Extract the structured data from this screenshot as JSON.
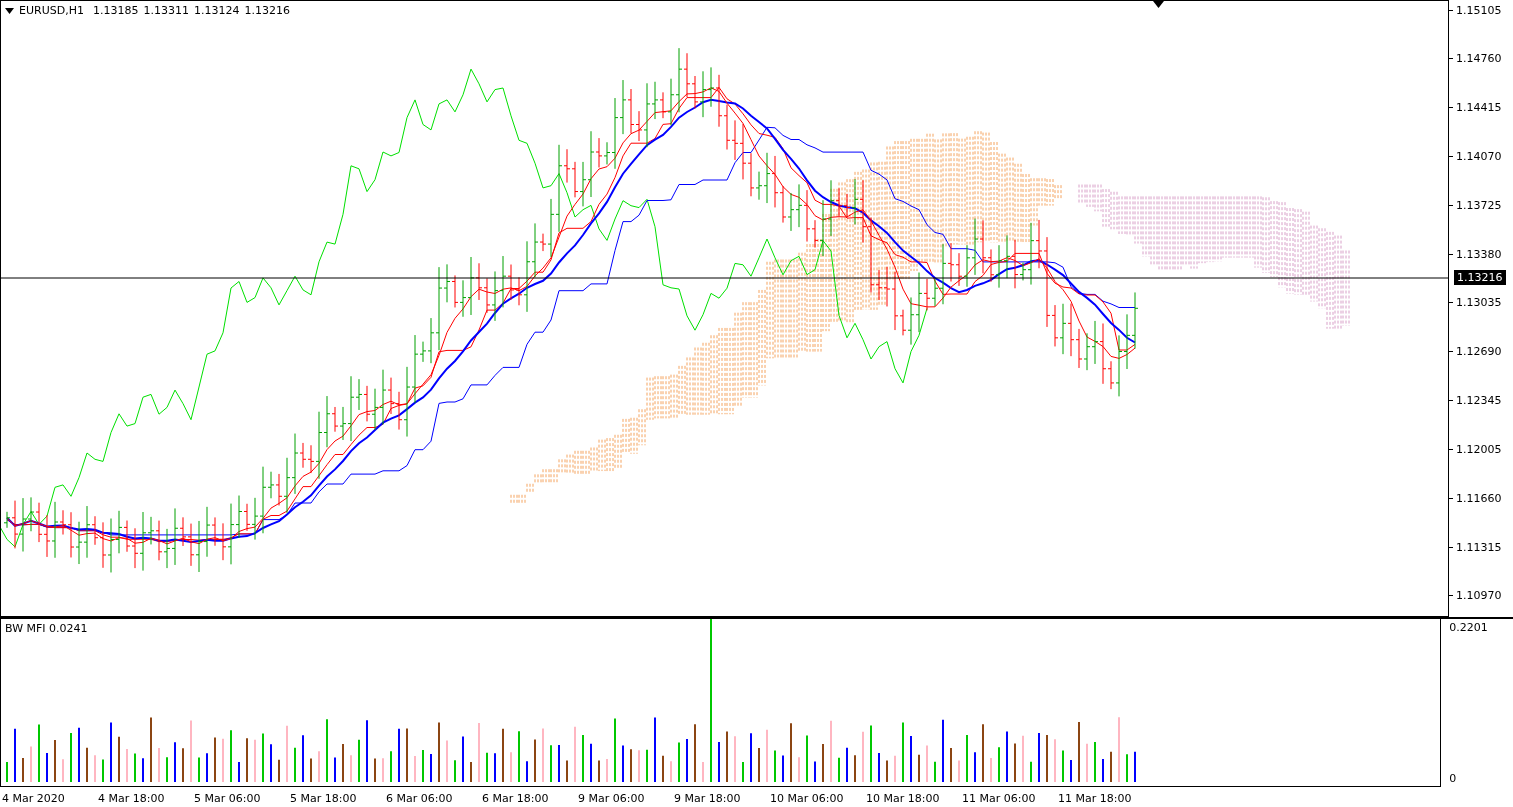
{
  "chart_header": {
    "title": "EURUSD,H1",
    "ohlc": [
      "1.13185",
      "1.13311",
      "1.13124",
      "1.13216"
    ]
  },
  "price_axis": {
    "ticks": [
      "1.15105",
      "1.14760",
      "1.14415",
      "1.14070",
      "1.13725",
      "1.13380",
      "1.13035",
      "1.12690",
      "1.12345",
      "1.12005",
      "1.11660",
      "1.11315",
      "1.10970"
    ],
    "current_price": "1.13216"
  },
  "indicator_window": {
    "title": "BW MFI 0.0241",
    "axis_ticks": [
      "0.2201",
      "0"
    ]
  },
  "time_axis": {
    "labels": [
      "4 Mar 2020",
      "4 Mar 18:00",
      "5 Mar 06:00",
      "5 Mar 18:00",
      "6 Mar 06:00",
      "6 Mar 18:00",
      "9 Mar 06:00",
      "9 Mar 18:00",
      "10 Mar 06:00",
      "10 Mar 18:00",
      "11 Mar 06:00",
      "11 Mar 18:00"
    ]
  }
}
